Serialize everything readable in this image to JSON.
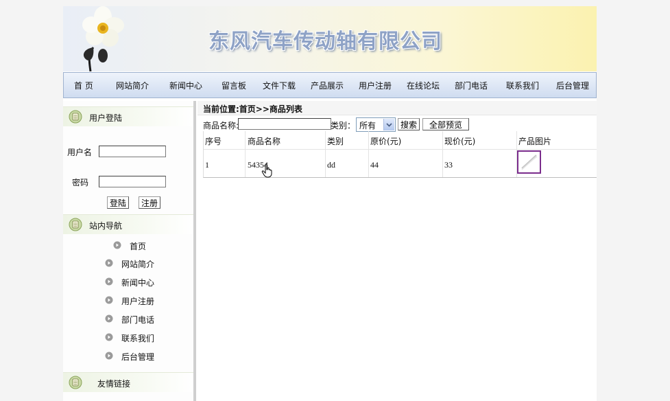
{
  "header": {
    "site_title": "东风汽车传动轴有限公司"
  },
  "nav": {
    "items": [
      {
        "label": "首  页"
      },
      {
        "label": "网站简介"
      },
      {
        "label": "新闻中心"
      },
      {
        "label": "留言板"
      },
      {
        "label": "文件下载"
      },
      {
        "label": "产品展示"
      },
      {
        "label": "用户注册"
      },
      {
        "label": "在线论坛"
      },
      {
        "label": "部门电话"
      },
      {
        "label": "联系我们"
      },
      {
        "label": "后台管理"
      }
    ]
  },
  "login": {
    "title": "用户登陆",
    "username_label": "用户名",
    "password_label": "密码",
    "login_button": "登陆",
    "register_button": "注册"
  },
  "site_nav": {
    "title": "站内导航",
    "items": [
      {
        "label": "首页"
      },
      {
        "label": "网站简介"
      },
      {
        "label": "新闻中心"
      },
      {
        "label": "用户注册"
      },
      {
        "label": "部门电话"
      },
      {
        "label": "联系我们"
      },
      {
        "label": "后台管理"
      }
    ]
  },
  "links": {
    "title": "友情链接"
  },
  "main": {
    "location": "当前位置:首页>>商品列表",
    "search": {
      "name_label": "商品名称:",
      "category_label": "类别：",
      "category_value": "所有",
      "search_button": "搜索",
      "preview_all_button": "全部预览"
    },
    "table": {
      "headers": [
        "序号",
        "商品名称",
        "类别",
        "原价(元)",
        "现价(元)",
        "产品图片"
      ],
      "rows": [
        {
          "index": "1",
          "name": "54354",
          "category": "dd",
          "original_price": "44",
          "current_price": "33"
        }
      ]
    }
  },
  "colors": {
    "thumb_border": "#7a2c8c",
    "title_text": "#8ea2c6"
  }
}
